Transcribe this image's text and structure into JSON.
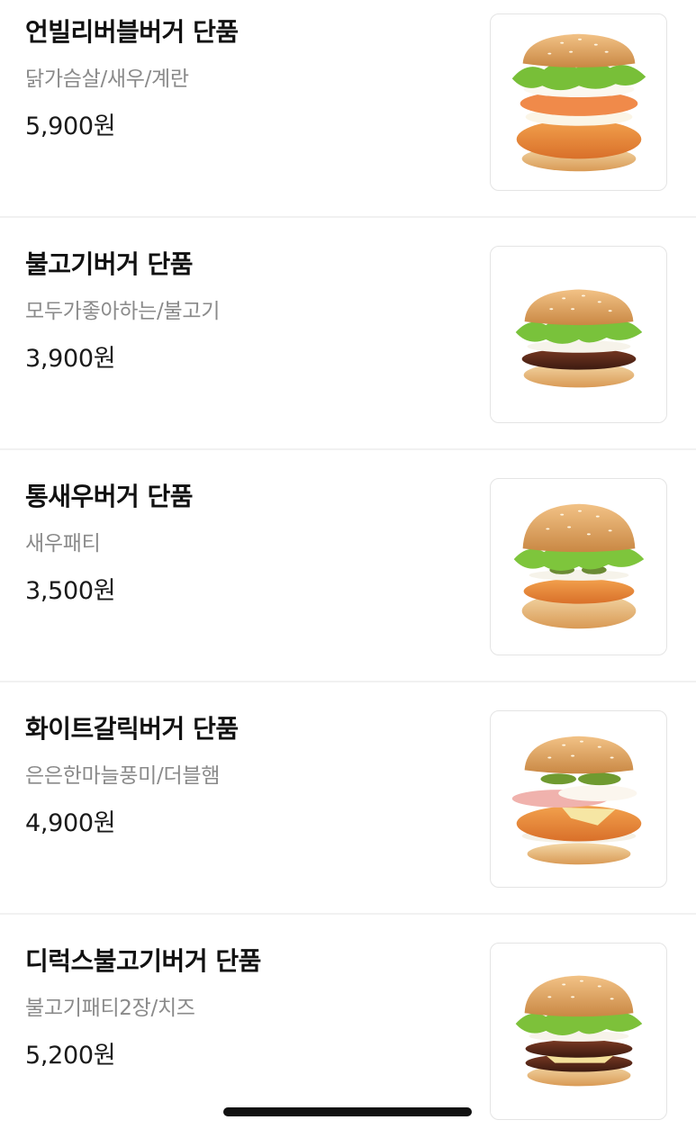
{
  "menu": {
    "items": [
      {
        "name": "언빌리버블버거 단품",
        "desc": "닭가슴살/새우/계란",
        "price": "5,900원",
        "image": "unbelievable-burger-image"
      },
      {
        "name": "불고기버거 단품",
        "desc": "모두가좋아하는/불고기",
        "price": "3,900원",
        "image": "bulgogi-burger-image"
      },
      {
        "name": "통새우버거 단품",
        "desc": "새우패티",
        "price": "3,500원",
        "image": "shrimp-burger-image"
      },
      {
        "name": "화이트갈릭버거 단품",
        "desc": "은은한마늘풍미/더블햄",
        "price": "4,900원",
        "image": "white-garlic-burger-image"
      },
      {
        "name": "디럭스불고기버거 단품",
        "desc": "불고기패티2장/치즈",
        "price": "5,200원",
        "image": "deluxe-bulgogi-burger-image"
      }
    ]
  },
  "colors": {
    "bun": "#e1a660",
    "lettuce": "#7cc23c",
    "fried": "#e98a3a",
    "patty": "#5a2a1c",
    "divider": "#f1f1f1"
  }
}
